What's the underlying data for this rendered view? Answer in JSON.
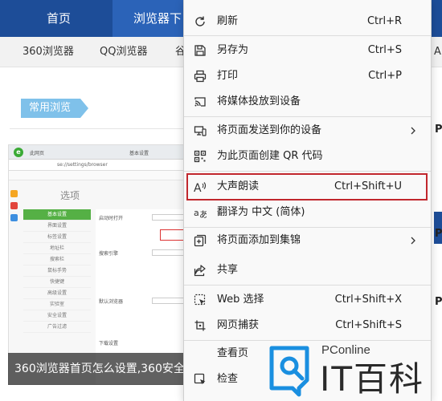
{
  "background": {
    "topnav": {
      "home": "首页",
      "browser": "浏览器下"
    },
    "subnav": [
      "360浏览器",
      "QQ浏览器",
      "谷",
      "A"
    ],
    "section_tag": "常用浏览",
    "screenshot": {
      "tab1": "此网页",
      "tab2": "基本设置",
      "address": "se://settings/browser",
      "title": "选项",
      "menu": [
        "基本设置",
        "界面设置",
        "标签设置",
        "地址栏",
        "搜索栏",
        "鼠标手势",
        "快捷键",
        "高级设置",
        "实验室",
        "安全设置",
        "广告过滤"
      ],
      "labels": [
        "启动时打开",
        "搜索引擎",
        "默认浏览器",
        "下载设置"
      ]
    },
    "caption": "360浏览器首页怎么设置,360安全",
    "right_letters": [
      "P",
      "P",
      "P"
    ]
  },
  "menu": {
    "items": [
      {
        "label": "刷新",
        "shortcut": "Ctrl+R",
        "icon": "refresh-icon"
      },
      {
        "label": "另存为",
        "shortcut": "Ctrl+S",
        "icon": "save-as-icon"
      },
      {
        "label": "打印",
        "shortcut": "Ctrl+P",
        "icon": "print-icon"
      },
      {
        "label": "将媒体投放到设备",
        "shortcut": "",
        "icon": "cast-icon"
      },
      {
        "label": "将页面发送到你的设备",
        "shortcut": "",
        "icon": "send-to-device-icon"
      },
      {
        "label": "为此页面创建 QR 代码",
        "shortcut": "",
        "icon": "qr-code-icon"
      },
      {
        "label": "大声朗读",
        "shortcut": "Ctrl+Shift+U",
        "icon": "read-aloud-icon"
      },
      {
        "label": "翻译为 中文 (简体)",
        "shortcut": "",
        "icon": "translate-icon"
      },
      {
        "label": "将页面添加到集锦",
        "shortcut": "",
        "icon": "collections-icon"
      },
      {
        "label": "共享",
        "shortcut": "",
        "icon": "share-icon"
      },
      {
        "label": "Web 选择",
        "shortcut": "Ctrl+Shift+X",
        "icon": "web-select-icon"
      },
      {
        "label": "网页捕获",
        "shortcut": "Ctrl+Shift+S",
        "icon": "web-capture-icon"
      },
      {
        "label": "查看页",
        "shortcut": "",
        "icon": "view-source-icon"
      },
      {
        "label": "检查",
        "shortcut": "",
        "icon": "inspect-icon"
      }
    ]
  },
  "watermark": {
    "pc": "PConline",
    "brand": "IT百科"
  },
  "colors": {
    "nav": "#1d4d98",
    "highlight": "#c1272d",
    "menu_bg": "#f9f9f9",
    "accent": "#1a8fe0"
  }
}
